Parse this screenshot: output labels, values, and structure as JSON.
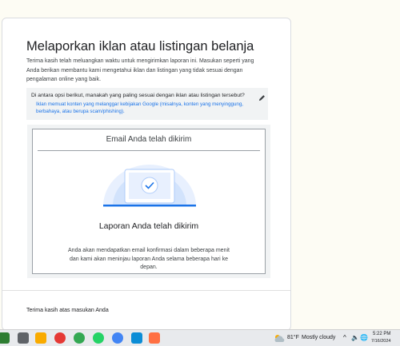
{
  "form": {
    "title": "Melaporkan iklan atau listingan belanja",
    "intro": "Terima kasih telah meluangkan waktu untuk mengirimkan laporan ini. Masukan seperti yang Anda berikan membantu kami mengetahui iklan dan listingan yang tidak sesuai dengan pengalaman online yang baik.",
    "question": "Di antara opsi berikut, manakah yang paling sesuai dengan iklan atau listingan tersebut?",
    "answer": "Iklan memuat konten yang melanggar kebijakan Google (misalnya, konten yang menyinggung, berbahaya, atau berupa scam/phishing).",
    "edit_icon": "pencil-icon",
    "confirmation": {
      "heading": "Email Anda telah dikirim",
      "illustration_icon": "laptop-checkmark-icon",
      "status": "Laporan Anda telah dikirim",
      "detail": "Anda akan mendapatkan email konfirmasi dalam beberapa menit dan kami akan meninjau laporan Anda selama beberapa hari ke depan."
    },
    "footer": "Terima kasih atas masukan Anda"
  },
  "taskbar": {
    "apps": [
      {
        "icon": "chat-icon",
        "color": "#2e7d32"
      },
      {
        "icon": "calculator-icon",
        "color": "#5f6368"
      },
      {
        "icon": "sticky-notes-icon",
        "color": "#f9ab00"
      },
      {
        "icon": "app-badge-icon",
        "color": "#e53935"
      },
      {
        "icon": "chrome-icon",
        "color": "#34a853"
      },
      {
        "icon": "whatsapp-icon",
        "color": "#25d366"
      },
      {
        "icon": "chrome-profile-icon",
        "color": "#4285f4"
      },
      {
        "icon": "edge-icon",
        "color": "#0c8dd6"
      },
      {
        "icon": "active-app-icon",
        "color": "#ff7043"
      }
    ],
    "weather": {
      "icon": "cloud-icon",
      "temp": "81°F",
      "desc": "Mostly cloudy"
    },
    "tray": [
      "^",
      "🔈",
      "🌐",
      "🔋"
    ],
    "time": "5:22 PM",
    "date": "7/16/2024"
  },
  "colors": {
    "accent": "#1a73e8",
    "panel": "#f1f3f4",
    "page_bg": "#fdfcf4"
  }
}
